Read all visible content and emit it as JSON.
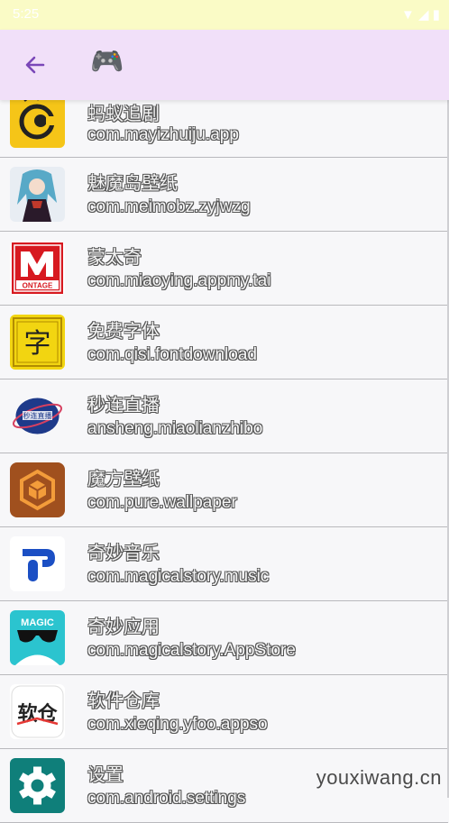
{
  "status_bar": {
    "time": "5:25",
    "icons": "▼ ◢ ▮"
  },
  "app_bar": {
    "back_icon": "arrow-left-icon",
    "title_icon": "🎮"
  },
  "apps": [
    {
      "name": "蚂蚁追剧",
      "package": "com.mayizhuiju.app",
      "icon": "ant-icon",
      "color": "#f5c518"
    },
    {
      "name": "魅魔岛壁纸",
      "package": "com.meimobz.zyjwzg",
      "icon": "anime-girl-icon",
      "color": "#e8edf3"
    },
    {
      "name": "蒙太奇",
      "package": "com.miaoying.appmy.tai",
      "icon": "montage-icon",
      "color": "#d71920"
    },
    {
      "name": "免费字体",
      "package": "com.qisi.fontdownload",
      "icon": "font-icon",
      "color": "#f2d511"
    },
    {
      "name": "秒连直播",
      "package": "ansheng.miaolianzhibo",
      "icon": "live-icon",
      "color": "#1e3a8a"
    },
    {
      "name": "魔方壁纸",
      "package": "com.pure.wallpaper",
      "icon": "cube-icon",
      "color": "#a0501e"
    },
    {
      "name": "奇妙音乐",
      "package": "com.magicalstory.music",
      "icon": "music-icon",
      "color": "#1b4fc4"
    },
    {
      "name": "奇妙应用",
      "package": "com.magicalstory.AppStore",
      "icon": "magic-icon",
      "color": "#2bc4cf"
    },
    {
      "name": "软件仓库",
      "package": "com.xieqing.yfoo.appso",
      "icon": "software-store-icon",
      "color": "#ffffff"
    },
    {
      "name": "设置",
      "package": "com.android.settings",
      "icon": "settings-icon",
      "color": "#0f7f7a"
    }
  ],
  "watermark": "youxiwang.cn"
}
